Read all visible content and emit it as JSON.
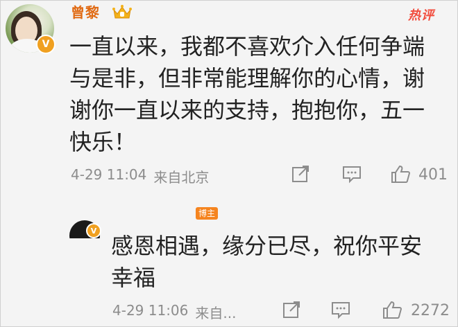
{
  "comment": {
    "author": "曾黎",
    "hot_label": "热评",
    "text": "一直以来，我都不喜欢介入任何争端与是非，但非常能理解你的心情，谢谢你一直以来的支持，抱抱你，五一快乐！",
    "date": "4-29 11:04",
    "location": "来自北京",
    "like_count": "401",
    "icons": [
      "avatar",
      "verified-v-icon",
      "vip-crown-icon",
      "share-icon",
      "comment-icon",
      "like-icon"
    ]
  },
  "reply": {
    "author_tag": "博主",
    "text": "感恩相遇，缘分已尽，祝你平安幸福",
    "date": "4-29 11:06",
    "location": "来自...",
    "like_count": "2272"
  },
  "colors": {
    "username": "#e06a13",
    "hot": "#f24c3d",
    "text": "#222222",
    "meta": "#8c8c8c",
    "badge": "#f0a020",
    "author_tag": "#f5841f"
  }
}
